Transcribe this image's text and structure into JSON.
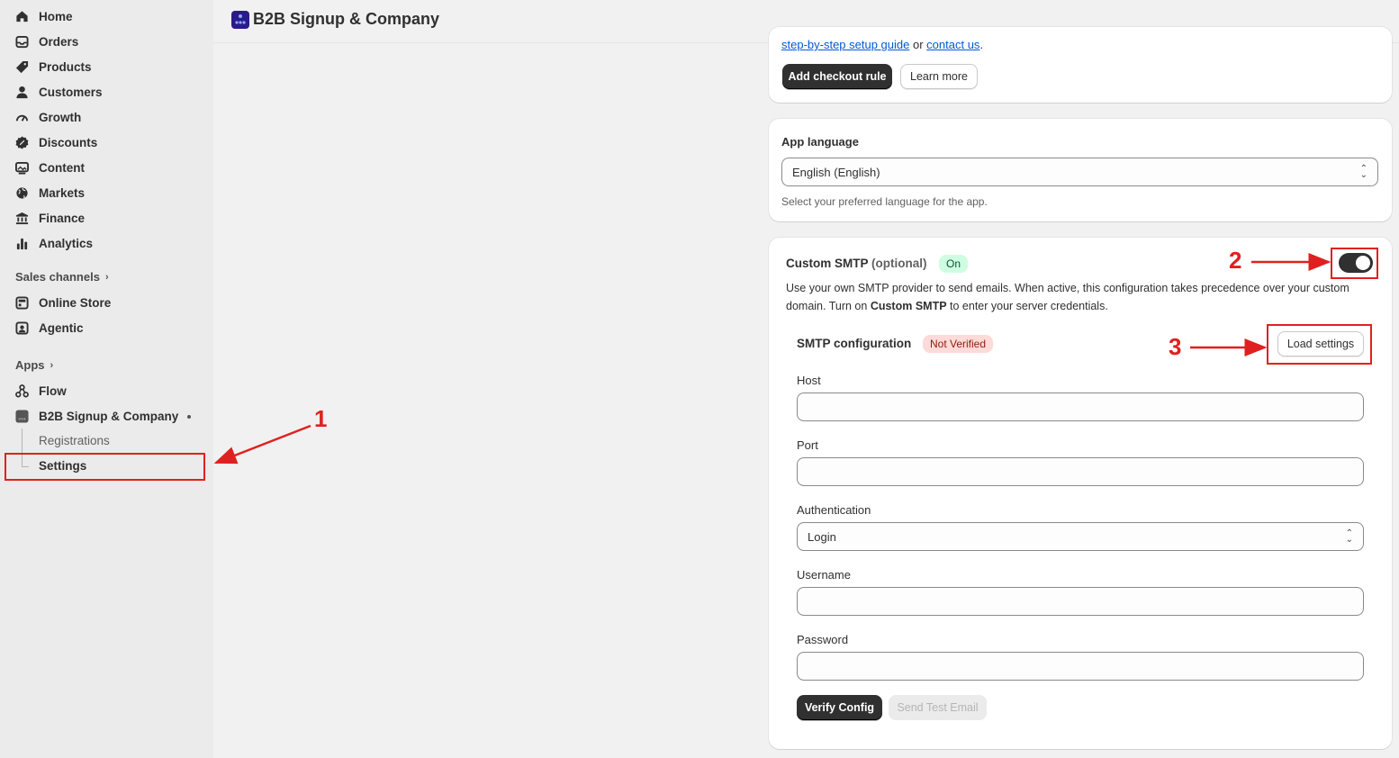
{
  "sidebar": {
    "items": [
      {
        "label": "Home",
        "icon": "home-icon"
      },
      {
        "label": "Orders",
        "icon": "inbox-icon"
      },
      {
        "label": "Products",
        "icon": "tag-icon"
      },
      {
        "label": "Customers",
        "icon": "person-icon"
      },
      {
        "label": "Growth",
        "icon": "gauge-icon"
      },
      {
        "label": "Discounts",
        "icon": "discount-icon"
      },
      {
        "label": "Content",
        "icon": "image-icon"
      },
      {
        "label": "Markets",
        "icon": "globe-icon"
      },
      {
        "label": "Finance",
        "icon": "bank-icon"
      },
      {
        "label": "Analytics",
        "icon": "bar-chart-icon"
      }
    ],
    "sales_channels_label": "Sales channels",
    "sales_channels": [
      {
        "label": "Online Store",
        "icon": "store-icon"
      },
      {
        "label": "Agentic",
        "icon": "agent-icon"
      }
    ],
    "apps_label": "Apps",
    "apps": [
      {
        "label": "Flow",
        "icon": "flow-icon"
      },
      {
        "label": "B2B Signup & Company",
        "icon": "app-icon"
      }
    ],
    "app_subitems": [
      {
        "label": "Registrations"
      },
      {
        "label": "Settings"
      }
    ]
  },
  "header": {
    "title": "B2B Signup & Company"
  },
  "checkout_card": {
    "text_link1": "step-by-step setup guide",
    "text_or": " or ",
    "text_link2": "contact us",
    "text_end": ".",
    "add_rule_button": "Add checkout rule",
    "learn_more_button": "Learn more"
  },
  "language_card": {
    "title": "App language",
    "selected": "English (English)",
    "help": "Select your preferred language for the app."
  },
  "smtp_card": {
    "title": "Custom SMTP",
    "optional": "(optional)",
    "status_badge": "On",
    "desc_part1": "Use your own SMTP provider to send emails. When active, this configuration takes precedence over your custom domain. Turn on ",
    "desc_bold": "Custom SMTP",
    "desc_part2": " to enter your server credentials.",
    "toggle_on": true,
    "config_title": "SMTP configuration",
    "config_badge": "Not Verified",
    "load_settings_button": "Load settings",
    "host_label": "Host",
    "host_value": "",
    "port_label": "Port",
    "port_value": "",
    "auth_label": "Authentication",
    "auth_value": "Login",
    "username_label": "Username",
    "username_value": "",
    "password_label": "Password",
    "password_value": "",
    "verify_button": "Verify Config",
    "send_test_button": "Send Test Email"
  },
  "annotations": {
    "n1": "1",
    "n2": "2",
    "n3": "3"
  },
  "colors": {
    "annotation_red": "#e02020",
    "badge_on_bg": "#cdfee1",
    "badge_on_text": "#0c5132",
    "badge_notverified_bg": "#fedad9",
    "badge_notverified_text": "#8e1f0b",
    "primary_button": "#303030"
  }
}
